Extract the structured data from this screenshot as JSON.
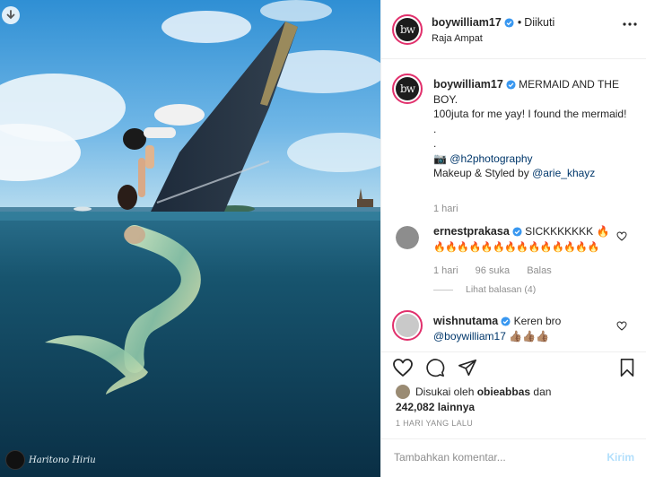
{
  "post_photo": {
    "watermark": "Haritono Hiriu"
  },
  "header": {
    "username": "boywilliam17",
    "separator": "•",
    "follow_status": "Diikuti",
    "location": "Raja Ampat"
  },
  "caption": {
    "username": "boywilliam17",
    "line1": "MERMAID AND THE BOY.",
    "line2": "100juta for me yay! I found the mermaid!",
    "dot1": ".",
    "dot2": ".",
    "camera_emoji": "📷",
    "credit_handle": "@h2photography",
    "makeup_prefix": "Makeup & Styled by",
    "makeup_handle": "@arie_khayz",
    "time": "1 hari"
  },
  "comments": [
    {
      "username": "ernestprakasa",
      "text": "SICKKKKKKK 🔥",
      "text_line2": "🔥🔥🔥🔥🔥🔥🔥🔥🔥🔥🔥🔥🔥🔥",
      "time": "1 hari",
      "likes": "96 suka",
      "reply_label": "Balas",
      "view_replies": "Lihat balasan (4)"
    },
    {
      "username": "wishnutama",
      "text": "Keren bro",
      "mention": "@boywilliam17",
      "emoji": "👍🏽👍🏽👍🏽"
    }
  ],
  "liked_by": {
    "prefix": "Disukai oleh",
    "user": "obieabbas",
    "conj": "dan",
    "count": "242,082",
    "suffix": "lainnya"
  },
  "timestamp": "1 HARI YANG LALU",
  "comment_box": {
    "placeholder": "Tambahkan komentar...",
    "post_label": "Kirim"
  },
  "colors": {
    "verified": "#3897f0",
    "link": "#00376b",
    "muted": "#8e8e8e",
    "post_disabled": "#b2dffc",
    "story_ring": "#e1306c"
  },
  "icons": {
    "like": "heart-icon",
    "comment": "comment-bubble-icon",
    "share": "paper-plane-icon",
    "save": "bookmark-icon",
    "more": "more-dots-icon",
    "download": "download-arrow-icon"
  }
}
